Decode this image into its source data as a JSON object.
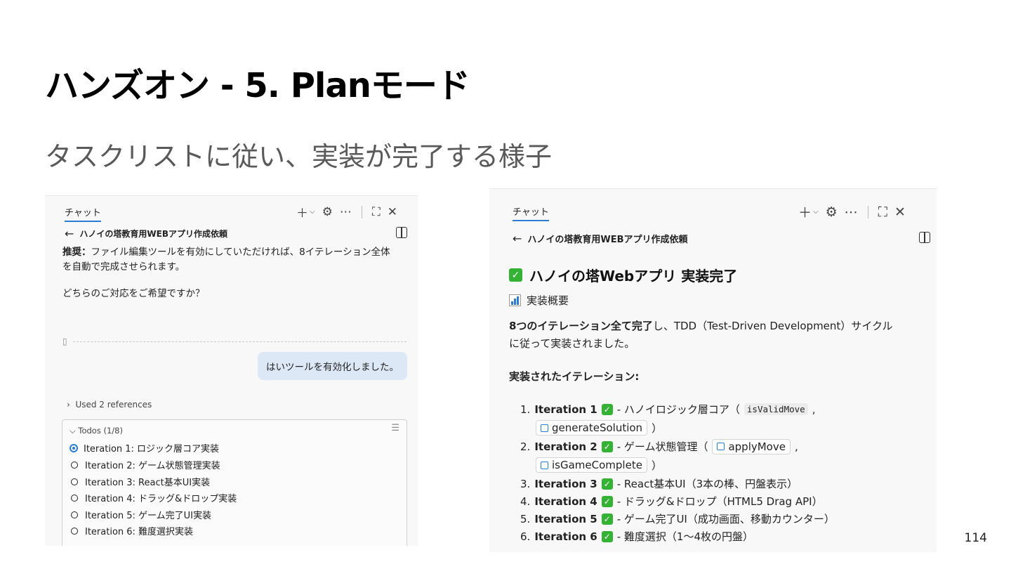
{
  "slide": {
    "title": "ハンズオン - 5. Planモード",
    "subtitle": "タスクリストに従い、実装が完了する様子",
    "page_number": "114"
  },
  "left_panel": {
    "tab_label": "チャット",
    "breadcrumb": "ハノイの塔教育用WEBアプリ作成依頼",
    "recommend_label": "推奨：",
    "recommend_text": "ファイル編集ツールを有効にしていただければ、8イテレーション全体",
    "recommend_text_2": "を自動で完成させられます。",
    "question": "どちらのご対応をご希望ですか？",
    "user_message": "はいツールを有効化しました。",
    "references": "Used 2 references",
    "todos_header": "Todos (1/8)",
    "todos": [
      {
        "label": "Iteration 1: ロジック層コア実装",
        "active": true
      },
      {
        "label": "Iteration 2: ゲーム状態管理実装",
        "active": false
      },
      {
        "label": "Iteration 3: React基本UI実装",
        "active": false
      },
      {
        "label": "Iteration 4: ドラッグ&ドロップ実装",
        "active": false
      },
      {
        "label": "Iteration 5: ゲーム完了UI実装",
        "active": false
      },
      {
        "label": "Iteration 6: 難度選択実装",
        "active": false
      }
    ]
  },
  "right_panel": {
    "tab_label": "チャット",
    "breadcrumb": "ハノイの塔教育用WEBアプリ作成依頼",
    "heading": "ハノイの塔Webアプリ 実装完了",
    "summary_label": "実装概要",
    "para_bold": "8つのイテレーション全て完了",
    "para_rest": "し、TDD（Test-Driven Development）サイクル",
    "para_line2": "に従って実装されました。",
    "section_title": "実装されたイテレーション:",
    "iterations": [
      {
        "num": "1.",
        "name": "Iteration 1",
        "desc": "- ハノイロジック層コア（",
        "code": "isValidMove",
        "after": ",",
        "cont_symbol": "generateSolution",
        "cont_after": "）"
      },
      {
        "num": "2.",
        "name": "Iteration 2",
        "desc": "- ゲーム状態管理（",
        "symbol": "applyMove",
        "after": ",",
        "cont_symbol": "isGameComplete",
        "cont_after": "）"
      },
      {
        "num": "3.",
        "name": "Iteration 3",
        "desc": "- React基本UI（3本の棒、円盤表示）"
      },
      {
        "num": "4.",
        "name": "Iteration 4",
        "desc": "- ドラッグ&ドロップ（HTML5 Drag API）"
      },
      {
        "num": "5.",
        "name": "Iteration 5",
        "desc": "- ゲーム完了UI（成功画面、移動カウンター）"
      },
      {
        "num": "6.",
        "name": "Iteration 6",
        "desc": "- 難度選択（1〜4枚の円盤）"
      }
    ]
  },
  "colors": {
    "accent": "#2b7cd3",
    "check_green": "#34b233",
    "bubble": "#dde8f7"
  }
}
